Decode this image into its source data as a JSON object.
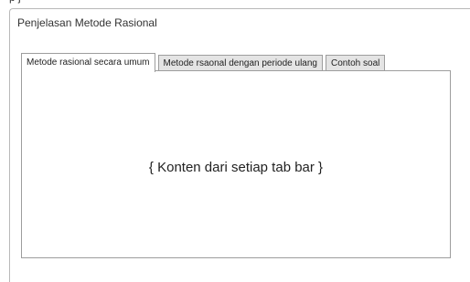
{
  "clipped_label": "p j",
  "window": {
    "title": "Penjelasan Metode Rasional"
  },
  "tabs": [
    {
      "label": "Metode rasional secara umum",
      "active": true
    },
    {
      "label": "Metode rsaonal dengan periode ulang",
      "active": false
    },
    {
      "label": "Contoh soal",
      "active": false
    }
  ],
  "panel": {
    "placeholder_text": "{ Konten dari setiap tab bar }"
  }
}
